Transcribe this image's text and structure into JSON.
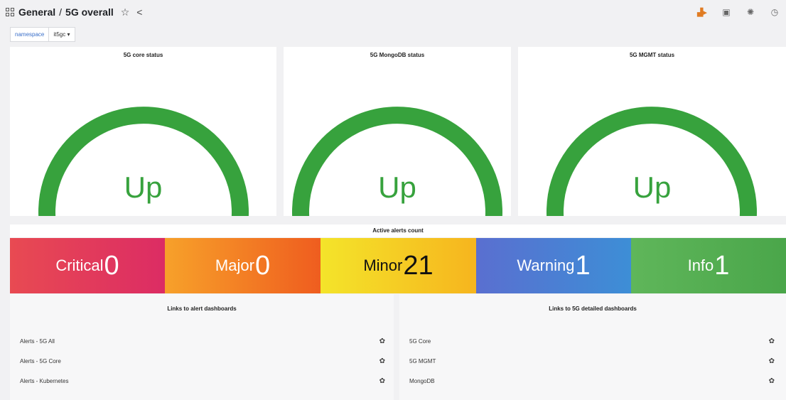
{
  "breadcrumb": {
    "folder": "General",
    "separator": "/",
    "dashboard": "5G overall"
  },
  "icons": {
    "star": "star-icon",
    "share": "share-icon"
  },
  "variable": {
    "label": "namespace",
    "value": "it5gc ▾"
  },
  "gauges": [
    {
      "title": "5G core status",
      "value": "Up"
    },
    {
      "title": "5G MongoDB status",
      "value": "Up"
    },
    {
      "title": "5G MGMT status",
      "value": "Up"
    }
  ],
  "colors": {
    "gauge": "#37a23d",
    "critical": "#e0385c",
    "major": "#f47c1e",
    "minor": "#f6c71b",
    "warning": "#4a7fd0",
    "info": "#55ad4f"
  },
  "alerts": {
    "title": "Active alerts count",
    "items": [
      {
        "label": "Critical",
        "value": "0"
      },
      {
        "label": "Major",
        "value": "0"
      },
      {
        "label": "Minor",
        "value": "21"
      },
      {
        "label": "Warning",
        "value": "1"
      },
      {
        "label": "Info",
        "value": "1"
      }
    ]
  },
  "alert_links": {
    "title": "Links to alert dashboards",
    "items": [
      "Alerts - 5G All",
      "Alerts - 5G Core",
      "Alerts - Kubernetes"
    ]
  },
  "detail_links": {
    "title": "Links to 5G detailed dashboards",
    "items": [
      "5G Core",
      "5G MGMT",
      "MongoDB"
    ]
  }
}
